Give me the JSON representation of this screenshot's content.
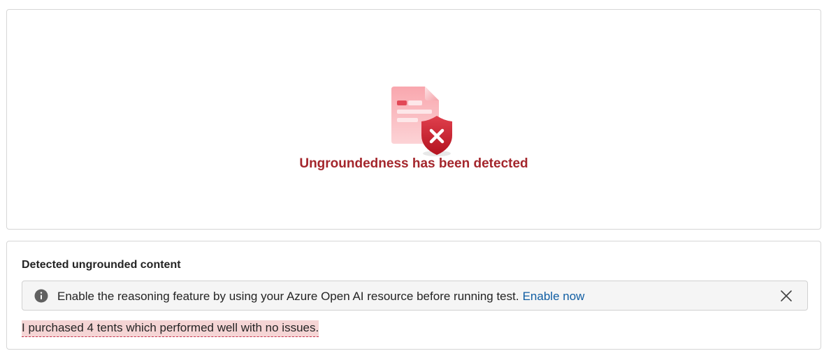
{
  "detection": {
    "title": "Ungroundedness has been detected",
    "icon": "document-shield-x-icon",
    "accent_color": "#a4262c"
  },
  "details": {
    "section_title": "Detected ungrounded content",
    "info_bar": {
      "icon": "info-icon",
      "message": "Enable the reasoning feature by using your Azure Open AI resource before running test.",
      "link_label": "Enable now",
      "close_icon": "close-icon"
    },
    "ungrounded_sentence": "I purchased 4 tents which performed well with no issues."
  }
}
